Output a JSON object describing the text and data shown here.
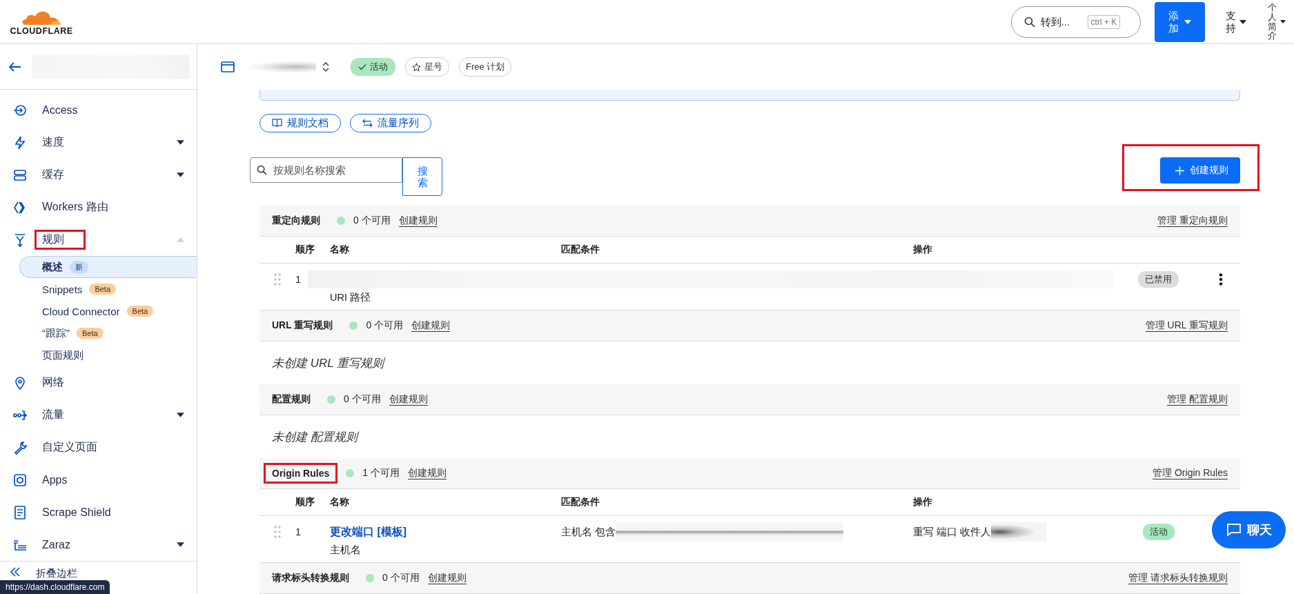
{
  "header": {
    "logo_text": "CLOUDFLARE",
    "search": {
      "placeholder": "转到...",
      "shortcut": "ctrl + K"
    },
    "add_button": "添加",
    "support_menu": "支持",
    "profile_menu": "个人简介"
  },
  "sidebar": {
    "back_field_redacted": true,
    "items": [
      {
        "label": "Access",
        "highlighted": false
      },
      {
        "label": "速度",
        "expanded": false,
        "highlighted": false
      },
      {
        "label": "缓存",
        "expanded": false,
        "highlighted": false
      },
      {
        "label": "Workers 路由",
        "highlighted": false
      },
      {
        "label": "规则",
        "expanded": true,
        "highlighted": true,
        "children": [
          {
            "label": "概述",
            "selected": true,
            "badge": {
              "text": "新",
              "kind": "new"
            }
          },
          {
            "label": "Snippets",
            "selected": false,
            "badge": {
              "text": "Beta",
              "kind": "beta"
            }
          },
          {
            "label": "Cloud Connector",
            "selected": false,
            "badge": {
              "text": "Beta",
              "kind": "beta"
            }
          },
          {
            "label": "“跟踪”",
            "selected": false,
            "badge": {
              "text": "Beta",
              "kind": "beta"
            }
          },
          {
            "label": "页面规则",
            "selected": false
          }
        ]
      },
      {
        "label": "网络",
        "highlighted": false
      },
      {
        "label": "流量",
        "expanded": false,
        "highlighted": false
      },
      {
        "label": "自定义页面",
        "highlighted": false
      },
      {
        "label": "Apps",
        "highlighted": false
      },
      {
        "label": "Scrape Shield",
        "highlighted": false
      },
      {
        "label": "Zaraz",
        "expanded": false,
        "highlighted": false
      }
    ],
    "collapse_label": "折叠边栏"
  },
  "zone_bar": {
    "name_redacted": true,
    "tags": [
      {
        "label": "活动",
        "kind": "status"
      },
      {
        "label": "星号",
        "kind": "star"
      },
      {
        "label": "Free 计划",
        "kind": "plan"
      }
    ]
  },
  "actions": [
    {
      "label": "规则文档",
      "kind": "docs"
    },
    {
      "label": "流量序列",
      "kind": "sequence"
    }
  ],
  "search": {
    "placeholder": "按规则名称搜索",
    "button": "搜索"
  },
  "create_button": {
    "label": "创建规则",
    "highlighted": true
  },
  "sections": [
    {
      "title": "重定向规则",
      "count": "0 个可用",
      "create_link": "创建规则",
      "manage_link": "管理 重定向规则",
      "highlighted": false,
      "columns": [
        "顺序",
        "名称",
        "匹配条件",
        "操作"
      ],
      "rows": [
        {
          "order": "1",
          "redacted": true,
          "subtitle": "URI 路径",
          "status": {
            "label": "已禁用",
            "kind": "disabled"
          },
          "menu": true
        }
      ]
    },
    {
      "title": "URL 重写规则",
      "count": "0 个可用",
      "create_link": "创建规则",
      "manage_link": "管理 URL 重写规则",
      "highlighted": false,
      "empty_message": "未创建 URL 重写规则"
    },
    {
      "title": "配置规则",
      "count": "0 个可用",
      "create_link": "创建规则",
      "manage_link": "管理 配置规则",
      "highlighted": false,
      "empty_message": "未创建 配置规则"
    },
    {
      "title": "Origin Rules",
      "count": "1 个可用",
      "create_link": "创建规则",
      "manage_link": "管理 Origin Rules",
      "highlighted": true,
      "columns": [
        "顺序",
        "名称",
        "匹配条件",
        "操作"
      ],
      "rows": [
        {
          "order": "1",
          "redacted": false,
          "name": "更改端口 [模板]",
          "subtitle": "主机名",
          "condition": "主机名 包含",
          "condition_redacted": true,
          "action": "重写 端口 收件人",
          "action_redacted": true,
          "status": {
            "label": "活动",
            "kind": "active"
          }
        }
      ]
    },
    {
      "title": "请求标头转换规则",
      "count": "0 个可用",
      "create_link": "创建规则",
      "manage_link": "管理 请求标头转换规则",
      "highlighted": false
    }
  ],
  "status_url": "https://dash.cloudflare.com",
  "chat_button": "聊天"
}
